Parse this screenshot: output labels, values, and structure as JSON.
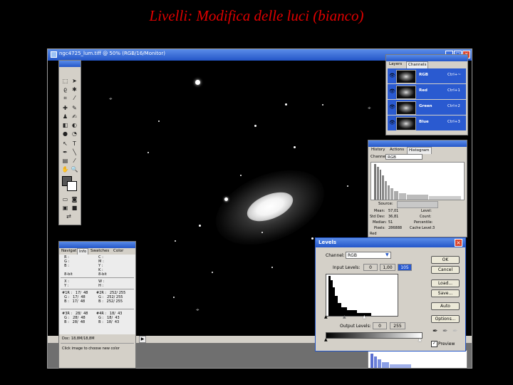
{
  "slide": {
    "title": "Livelli: Modifica delle luci (bianco)"
  },
  "document": {
    "title": "ngc4725_lum.tiff @ 50% (RGB/16/Monitor)",
    "status_doc": "Doc: 18,8M/18,8M",
    "zoom_label": "50%"
  },
  "channels_panel": {
    "tabs": [
      "Layers",
      "Channels"
    ],
    "channels": [
      {
        "name": "RGB",
        "shortcut": "Ctrl+~"
      },
      {
        "name": "Red",
        "shortcut": "Ctrl+1"
      },
      {
        "name": "Green",
        "shortcut": "Ctrl+2"
      },
      {
        "name": "Blue",
        "shortcut": "Ctrl+3"
      }
    ]
  },
  "histogram_panel": {
    "tabs": [
      "History",
      "Actions",
      "Histogram"
    ],
    "channel_label": "Channel:",
    "channel_value": "RGB",
    "source_label": "Source:",
    "stats": {
      "mean_label": "Mean:",
      "mean": "57,01",
      "stddev_label": "Std Dev:",
      "stddev": "36,81",
      "median_label": "Median:",
      "median": "51",
      "pixels_label": "Pixels:",
      "pixels": "286888",
      "level_label": "Level:",
      "count_label": "Count:",
      "percentile_label": "Percentile:",
      "cache_label": "Cache Level:",
      "cache": "3"
    },
    "footer_channel": "Red"
  },
  "info_panel": {
    "tabs": [
      "Navigat",
      "Info",
      "Swatches",
      "Color"
    ],
    "block1_left": "  R :\n  G :\n  B :\n\n  8-bit",
    "block1_right": "  C :\n  M :\n  Y :\n  K :\n  8-bit",
    "block2_left": "  X :\n  Y :",
    "block2_right": "  W :\n  H :",
    "block3_left": "#1R :   17/  48\n  G :   17/  48\n  B :   17/  48",
    "block3_right": "#2R :   252/ 255\n  G :   252/ 255\n  B :   252/ 255",
    "block4_left": "#3R :   28/  48\n  G :   28/  48\n  B :   28/  48",
    "block4_right": "#4R :   18/  43\n  G :   18/  43\n  B :   18/  43",
    "doc_size": "Doc: 18,8M/18,8M",
    "hint": "Click image to choose new color"
  },
  "levels_dialog": {
    "title": "Levels",
    "channel_label": "Channel:",
    "channel_value": "RGB",
    "input_levels_label": "Input Levels:",
    "input_black": "0",
    "input_gamma": "1,00",
    "input_white": "105",
    "output_levels_label": "Output Levels:",
    "output_black": "0",
    "output_white": "255",
    "buttons": {
      "ok": "OK",
      "cancel": "Cancel",
      "load": "Load...",
      "save": "Save...",
      "auto": "Auto",
      "options": "Options..."
    },
    "preview_label": "Preview",
    "preview_checked": "✓"
  }
}
